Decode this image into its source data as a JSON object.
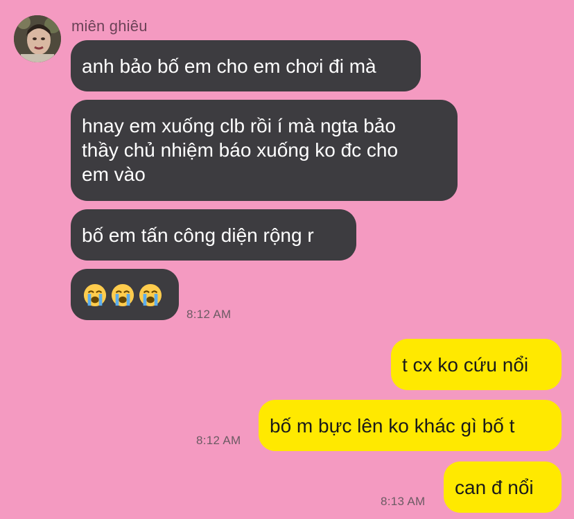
{
  "contact": {
    "name": "miên ghiêu"
  },
  "messages": {
    "m1": "anh bảo bố em cho em chơi đi mà",
    "m2_l1": "hnay em xuống clb rồi í mà ngta bảo",
    "m2_l2": "thầy chủ nhiệm báo xuống ko đc cho",
    "m2_l3": "em vào",
    "m3": "bố em tấn công diện rộng r",
    "m4_emoji": "loudly-crying-face-x3",
    "m5": "t cx ko cứu nổi",
    "m6": "bố m bực lên ko khác gì bố t",
    "m7": "can đ nổi"
  },
  "timestamps": {
    "t1": "8:12 AM",
    "t2": "8:12 AM",
    "t3": "8:13 AM"
  },
  "colors": {
    "background": "#f49ac1",
    "incoming_bubble": "#3d3c40",
    "outgoing_bubble": "#ffe900"
  }
}
